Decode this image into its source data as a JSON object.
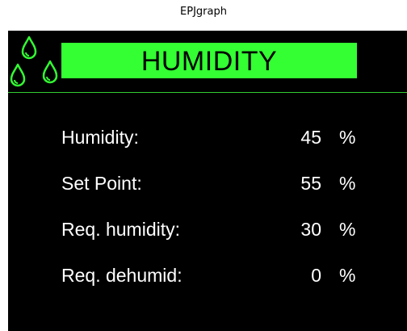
{
  "window": {
    "title": "EPJgraph"
  },
  "header": {
    "title": "HUMIDITY",
    "icon": "water-drops-icon"
  },
  "readings": [
    {
      "label": "Humidity:",
      "value": "45",
      "unit": "%"
    },
    {
      "label": "Set Point:",
      "value": "55",
      "unit": "%"
    },
    {
      "label": "Req. humidity:",
      "value": "30",
      "unit": "%"
    },
    {
      "label": "Req. dehumid:",
      "value": "0",
      "unit": "%"
    }
  ],
  "colors": {
    "background": "#000000",
    "accent": "#33ff33",
    "text": "#ffffff"
  }
}
